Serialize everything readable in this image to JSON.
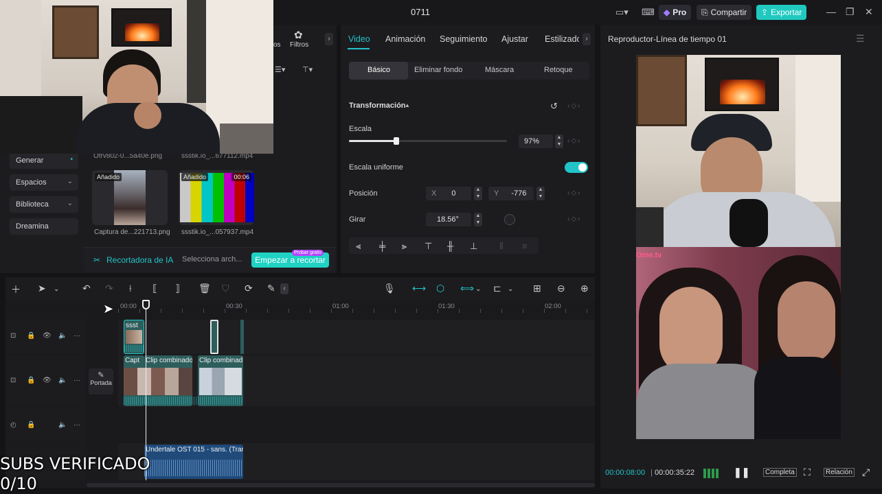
{
  "window": {
    "title": "0711",
    "pro_label": "Pro",
    "share_label": "Compartir",
    "export_label": "Exportar"
  },
  "media": {
    "tab_partial": "os",
    "filters_label": "Filtros",
    "cropped_file_1": "Ofrv802-0...5a40e.png",
    "cropped_file_2": "ssstik.io_...677112.mp4",
    "items": [
      {
        "name": "Captura de...221713.png",
        "badge": "Añadido"
      },
      {
        "name": "ssstik.io_...057937.mp4",
        "badge": "Añadido",
        "duration": "00:06"
      }
    ]
  },
  "sidebar": {
    "items": [
      {
        "label": "Generar"
      },
      {
        "label": "Espacios"
      },
      {
        "label": "Biblioteca"
      },
      {
        "label": "Dreamina"
      }
    ]
  },
  "ia_bar": {
    "title": "Recortadora de IA",
    "select_text": "Selecciona arch...",
    "button_label": "Empezar a recortar",
    "trial_badge": "Probar gratis"
  },
  "inspector": {
    "tabs": [
      "Video",
      "Animación",
      "Seguimiento",
      "Ajustar",
      "Estilizado"
    ],
    "subtabs": [
      "Básico",
      "Eliminar fondo",
      "Máscara",
      "Retoque"
    ],
    "section_title": "Transformación",
    "scale_label": "Escala",
    "scale_value": "97%",
    "scale_fraction": 0.3,
    "uniform_label": "Escala uniforme",
    "uniform_on": true,
    "position_label": "Posición",
    "pos_x_label": "X",
    "pos_x": "0",
    "pos_y_label": "Y",
    "pos_y": "-776",
    "rotate_label": "Girar",
    "rotate_value": "18.56°"
  },
  "player": {
    "title": "Reproductor-Línea de tiempo 01",
    "current_time": "00:00:08:00",
    "total_time": "00:00:35:22",
    "full_label": "Completa",
    "ratio_label": "Relación",
    "accent": "#22c4c8"
  },
  "timeline": {
    "ruler": [
      "00:00",
      "00:30",
      "01:00",
      "01:30",
      "02:00"
    ],
    "cover_label": "Portada",
    "clip_top_label": "ssst",
    "clip_a_label": "Capt",
    "clip_b_label": "Clip combinado",
    "clip_c_label": "Clip combinad",
    "audio_label": "Undertale OST 015 - sans. (Tranq"
  },
  "overlay": {
    "line1": "SUBS VERIFICADO",
    "line2": "0/10"
  }
}
